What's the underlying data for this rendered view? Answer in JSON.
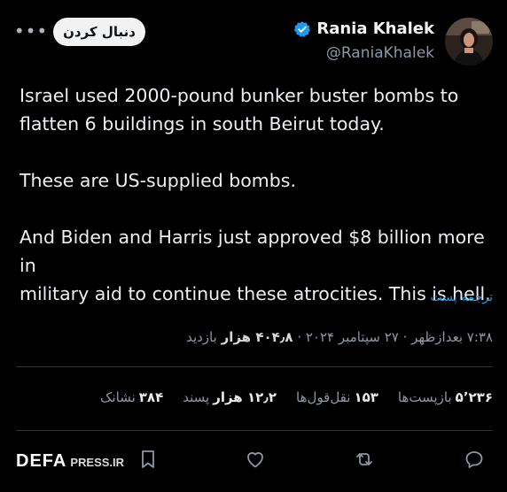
{
  "author": {
    "name": "Rania Khalek",
    "handle": "@RaniaKhalek",
    "verified": true,
    "avatar_icon": "profile-photo"
  },
  "header": {
    "follow_label": "دنبال کردن",
    "more_icon": "more-dots-icon"
  },
  "tweet": {
    "lines": [
      "Israel used 2000-pound bunker buster bombs to",
      "flatten 6 buildings in south Beirut today.",
      "These are US-supplied bombs.",
      "And Biden and Harris just approved $8 billion more in",
      "military aid to continue these atrocities. This is hell."
    ],
    "translate_label": "ترجمه پست"
  },
  "meta": {
    "time": "۷:۳۸ بعدازظهر",
    "date": "۲۷ سپتامبر ۲۰۲۴",
    "views_value": "۴۰۴٫۸ هزار",
    "views_label": "بازدید",
    "separator": "·"
  },
  "stats": [
    {
      "value": "۵٬۲۳۶",
      "label": "بازپست‌ها"
    },
    {
      "value": "۱۵۳",
      "label": "نقل‌قول‌ها"
    },
    {
      "value": "۱۲٫۲ هزار",
      "label": "پسند"
    },
    {
      "value": "۳۸۴",
      "label": "نشانک"
    }
  ],
  "actions": [
    "reply-icon",
    "repost-icon",
    "like-icon",
    "bookmark-icon"
  ],
  "watermark": {
    "brand": "DEFA",
    "site": "PRESS.IR"
  },
  "colors": {
    "background": "#000000",
    "text": "#e7e9ea",
    "muted": "#8b98a5",
    "link": "#1d9bf0",
    "verified": "#1d9bf0"
  }
}
